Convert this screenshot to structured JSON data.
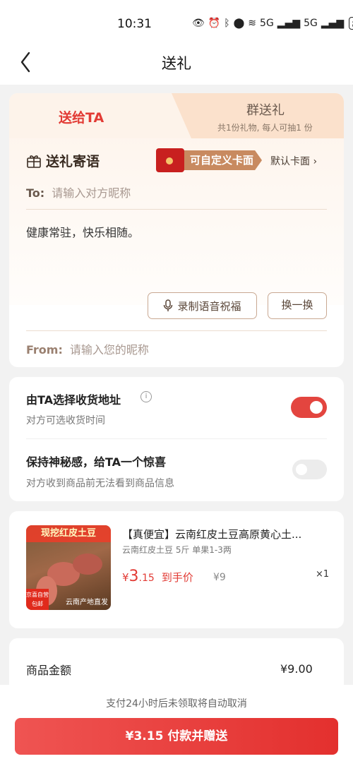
{
  "status": {
    "time": "10:31",
    "network1": "5G",
    "network2": "5G",
    "battery": "80"
  },
  "nav": {
    "title": "送礼"
  },
  "tabs": {
    "left": "送给TA",
    "right": "群送礼",
    "right_sub": "共1份礼物, 每人可抽1 份"
  },
  "message": {
    "title": "送礼寄语",
    "card_face_label": "可自定义卡面",
    "default_card": "默认卡面 ›",
    "to_label": "To:",
    "to_placeholder": "请输入对方昵称",
    "text": "健康常驻，快乐相随。",
    "voice_label": "录制语音祝福",
    "swap_label": "换一换",
    "from_label": "From:",
    "from_placeholder": "请输入您的昵称"
  },
  "options": {
    "address_title": "由TA选择收货地址",
    "address_sub": "对方可选收货时间",
    "address_enabled": true,
    "secret_title": "保持神秘感，给TA一个惊喜",
    "secret_sub": "对方收到商品前无法看到商品信息",
    "secret_enabled": false
  },
  "product": {
    "image_banner": "现挖红皮土豆",
    "image_badge_top": "京喜自营",
    "image_badge_bottom": "包邮",
    "image_origin": "云南产地直发",
    "title": "【真便宜】云南红皮土豆高原黄心土...",
    "spec": "云南红皮土豆 5斤 单果1-3两",
    "price_symbol": "¥",
    "price_int": "3",
    "price_dec": ".15",
    "price_tag": "到手价",
    "original_price": "¥9",
    "quantity": "×1"
  },
  "summary": {
    "label": "商品金额",
    "value": "¥9.00"
  },
  "footer": {
    "notice": "支付24小时后未领取将自动取消",
    "pay_button": "¥3.15 付款并赠送"
  },
  "colors": {
    "accent": "#e23b35",
    "tab_bg": "#fbe1cc",
    "card_tint": "#fdf3ea"
  }
}
